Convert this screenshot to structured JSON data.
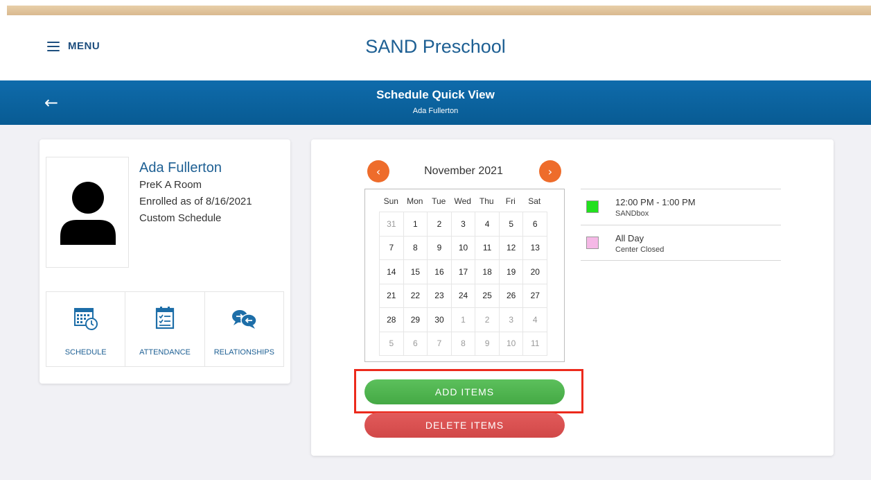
{
  "header": {
    "menu_label": "MENU",
    "brand": "SAND Preschool"
  },
  "titlebar": {
    "title": "Schedule Quick View",
    "subtitle": "Ada Fullerton",
    "back_icon": "←"
  },
  "profile": {
    "name": "Ada Fullerton",
    "room": "PreK A Room",
    "enrolled": "Enrolled as of 8/16/2021",
    "schedule_type": "Custom Schedule",
    "tiles": [
      {
        "label": "SCHEDULE",
        "icon": "calendar-clock-icon"
      },
      {
        "label": "ATTENDANCE",
        "icon": "checklist-icon"
      },
      {
        "label": "RELATIONSHIPS",
        "icon": "chat-bubbles-icon"
      }
    ]
  },
  "calendar": {
    "month_label": "November 2021",
    "prev_icon": "‹",
    "next_icon": "›",
    "days_of_week": [
      "Sun",
      "Mon",
      "Tue",
      "Wed",
      "Thu",
      "Fri",
      "Sat"
    ],
    "weeks": [
      [
        {
          "d": "31",
          "o": true
        },
        {
          "d": "1"
        },
        {
          "d": "2"
        },
        {
          "d": "3"
        },
        {
          "d": "4"
        },
        {
          "d": "5"
        },
        {
          "d": "6"
        }
      ],
      [
        {
          "d": "7"
        },
        {
          "d": "8"
        },
        {
          "d": "9"
        },
        {
          "d": "10"
        },
        {
          "d": "11"
        },
        {
          "d": "12"
        },
        {
          "d": "13"
        }
      ],
      [
        {
          "d": "14"
        },
        {
          "d": "15"
        },
        {
          "d": "16"
        },
        {
          "d": "17"
        },
        {
          "d": "18"
        },
        {
          "d": "19"
        },
        {
          "d": "20"
        }
      ],
      [
        {
          "d": "21"
        },
        {
          "d": "22"
        },
        {
          "d": "23"
        },
        {
          "d": "24"
        },
        {
          "d": "25"
        },
        {
          "d": "26"
        },
        {
          "d": "27"
        }
      ],
      [
        {
          "d": "28"
        },
        {
          "d": "29"
        },
        {
          "d": "30"
        },
        {
          "d": "1",
          "o": true
        },
        {
          "d": "2",
          "o": true
        },
        {
          "d": "3",
          "o": true
        },
        {
          "d": "4",
          "o": true
        }
      ],
      [
        {
          "d": "5",
          "o": true
        },
        {
          "d": "6",
          "o": true
        },
        {
          "d": "7",
          "o": true
        },
        {
          "d": "8",
          "o": true
        },
        {
          "d": "9",
          "o": true
        },
        {
          "d": "10",
          "o": true
        },
        {
          "d": "11",
          "o": true
        }
      ]
    ]
  },
  "legend": [
    {
      "time": "12:00 PM - 1:00 PM",
      "label": "SANDbox",
      "color": "#22e01e"
    },
    {
      "time": "All Day",
      "label": "Center Closed",
      "color": "#f5b8e6"
    }
  ],
  "actions": {
    "add_label": "ADD ITEMS",
    "delete_label": "DELETE ITEMS"
  },
  "colors": {
    "accent_blue": "#0f6bab",
    "nav_orange": "#ee6c2b",
    "add_green": "#4caf50",
    "delete_red": "#d94e4e",
    "highlight_red": "#ec2a1c"
  }
}
